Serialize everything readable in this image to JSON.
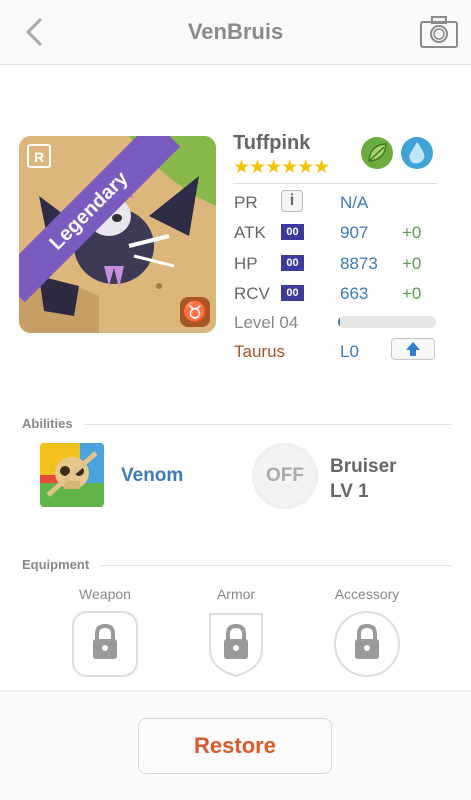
{
  "header": {
    "title": "VenBruis",
    "back_icon": "chevron-left-icon",
    "camera_icon": "camera-icon"
  },
  "monster": {
    "name": "Tuffpink",
    "rarity_tag": "Legendary",
    "rarity_badge": "R",
    "zodiac_symbol": "♉",
    "stars": "★★★★★★",
    "star_count": 6,
    "elements": [
      "leaf-element-icon",
      "water-element-icon"
    ]
  },
  "stats": {
    "pr": {
      "label": "PR",
      "value": "N/A"
    },
    "atk": {
      "label": "ATK",
      "boost": "00",
      "value": "907",
      "plus": "+0"
    },
    "hp": {
      "label": "HP",
      "boost": "00",
      "value": "8873",
      "plus": "+0"
    },
    "rcv": {
      "label": "RCV",
      "boost": "00",
      "value": "663",
      "plus": "+0"
    },
    "level": {
      "label": "Level 04",
      "progress": 0.02
    },
    "zodiac": {
      "label": "Taurus",
      "value": "L0"
    }
  },
  "abilities": {
    "section_title": "Abilities",
    "ability_name": "Venom",
    "leader_toggle": "OFF",
    "leader_name": "Bruiser",
    "leader_level": "LV 1"
  },
  "equipment": {
    "section_title": "Equipment",
    "slots": [
      {
        "label": "Weapon"
      },
      {
        "label": "Armor"
      },
      {
        "label": "Accessory"
      }
    ]
  },
  "footer": {
    "restore_label": "Restore",
    "restore_color": "#d95a2b"
  },
  "colors": {
    "stat_value": "#3d7ab8",
    "bonus": "#5aa04a",
    "taurus": "#a65524",
    "legendary": "#7c5bc0"
  }
}
